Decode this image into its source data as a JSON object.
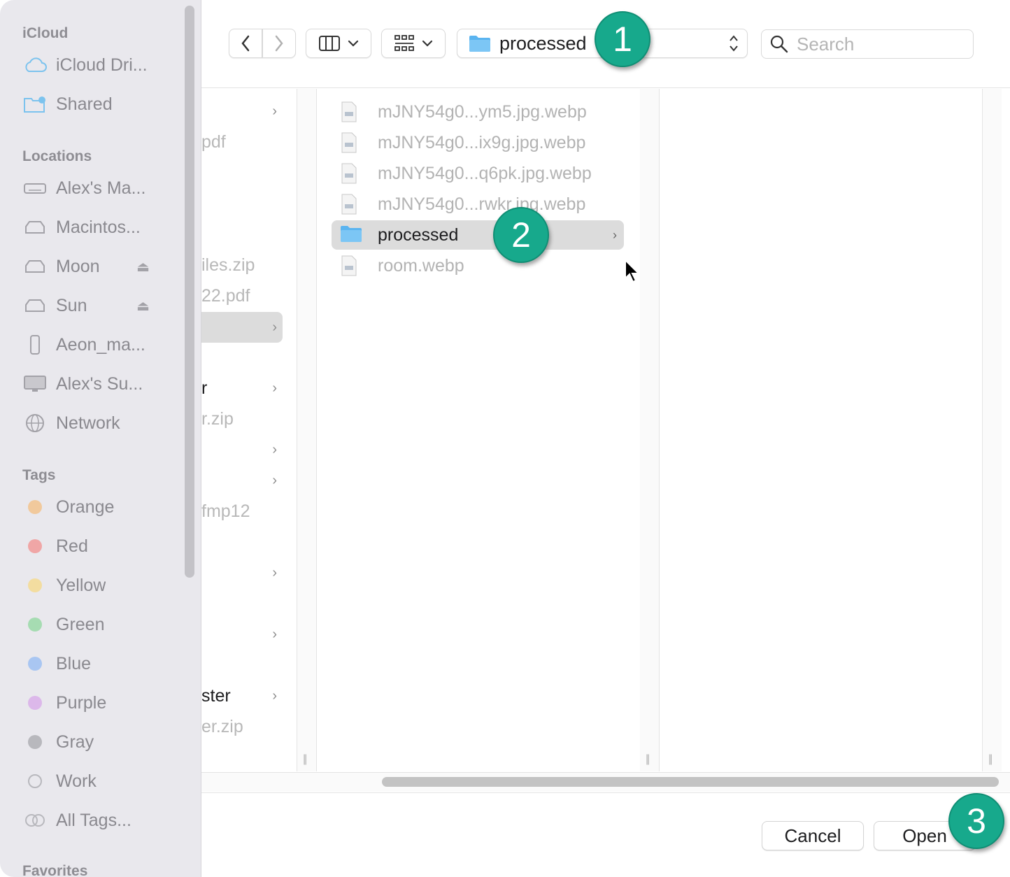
{
  "sidebar": {
    "sections": {
      "icloud": "iCloud",
      "locations": "Locations",
      "tags": "Tags",
      "favorites": "Favorites"
    },
    "icloud_items": [
      {
        "label": "iCloud Dri...",
        "icon": "cloud-icon"
      },
      {
        "label": "Shared",
        "icon": "shared-folder-icon"
      }
    ],
    "location_items": [
      {
        "label": "Alex's Ma...",
        "icon": "computer-drive-icon"
      },
      {
        "label": "Macintos...",
        "icon": "disk-icon"
      },
      {
        "label": "Moon",
        "icon": "disk-icon",
        "eject": true
      },
      {
        "label": "Sun",
        "icon": "disk-icon",
        "eject": true
      },
      {
        "label": "Aeon_ma...",
        "icon": "server-icon"
      },
      {
        "label": "Alex's Su...",
        "icon": "display-icon"
      },
      {
        "label": "Network",
        "icon": "globe-icon"
      }
    ],
    "tag_items": [
      {
        "label": "Orange",
        "color": "#f1c99c"
      },
      {
        "label": "Red",
        "color": "#f0a6a6"
      },
      {
        "label": "Yellow",
        "color": "#f3dda0"
      },
      {
        "label": "Green",
        "color": "#a6dcb2"
      },
      {
        "label": "Blue",
        "color": "#a9c6f2"
      },
      {
        "label": "Purple",
        "color": "#dcb8ea"
      },
      {
        "label": "Gray",
        "color": "#b8b8bd"
      },
      {
        "label": "Work",
        "color": "none"
      },
      {
        "label": "All Tags...",
        "color": "all"
      }
    ]
  },
  "toolbar": {
    "back": "‹",
    "forward": "›",
    "path_label": "processed",
    "search_placeholder": "Search"
  },
  "column1": [
    {
      "text": "",
      "chevron": true,
      "dark": false
    },
    {
      "text": "pdf",
      "chevron": false,
      "dark": false
    },
    {
      "text": "iles.zip",
      "chevron": false,
      "dark": false
    },
    {
      "text": "22.pdf",
      "chevron": false,
      "dark": false
    },
    {
      "text": "",
      "chevron": true,
      "dark": false,
      "selected": true
    },
    {
      "text": "r",
      "chevron": true,
      "dark": true
    },
    {
      "text": "r.zip",
      "chevron": false,
      "dark": false
    },
    {
      "text": "",
      "chevron": true,
      "dark": false
    },
    {
      "text": "",
      "chevron": true,
      "dark": false
    },
    {
      "text": "fmp12",
      "chevron": false,
      "dark": false
    },
    {
      "text": "",
      "chevron": true,
      "dark": false
    },
    {
      "text": "",
      "chevron": true,
      "dark": false
    },
    {
      "text": "ster",
      "chevron": true,
      "dark": true
    },
    {
      "text": "er.zip",
      "chevron": false,
      "dark": false
    }
  ],
  "column2": [
    {
      "name": "mJNY54g0...ym5.jpg.webp",
      "type": "file"
    },
    {
      "name": "mJNY54g0...ix9g.jpg.webp",
      "type": "file"
    },
    {
      "name": "mJNY54g0...q6pk.jpg.webp",
      "type": "file"
    },
    {
      "name": "mJNY54g0...rwkr.jpg.webp",
      "type": "file"
    },
    {
      "name": "processed",
      "type": "folder",
      "selected": true
    },
    {
      "name": "room.webp",
      "type": "file"
    }
  ],
  "footer": {
    "cancel": "Cancel",
    "open": "Open"
  },
  "callouts": [
    "1",
    "2",
    "3"
  ],
  "colors": {
    "accent_callout": "#17a98c",
    "folder_blue": "#5ab4f0",
    "sidebar_bg": "#e9e8ed"
  }
}
